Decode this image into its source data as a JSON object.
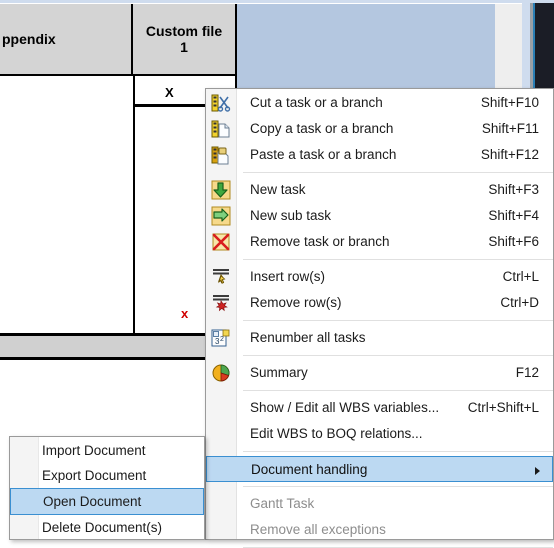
{
  "grid": {
    "columns": [
      {
        "name": "appendix-header",
        "label": "ppendix"
      },
      {
        "name": "custom-file-1-header",
        "label": "Custom file\n1"
      }
    ],
    "cells": [
      {
        "name": "custom-file-mark",
        "value": "X",
        "color": "#000000"
      },
      {
        "name": "appendix-mark",
        "value": "x",
        "color": "#d00000"
      }
    ]
  },
  "context_menu": {
    "name": "task-context-menu",
    "items": [
      {
        "id": "cut",
        "label": "Cut a task or a branch",
        "accel": "Shift+F10",
        "icon": "cut-icon",
        "state": "normal"
      },
      {
        "id": "copy",
        "label": "Copy a task or a branch",
        "accel": "Shift+F11",
        "icon": "copy-icon",
        "state": "normal"
      },
      {
        "id": "paste",
        "label": "Paste a task or a branch",
        "accel": "Shift+F12",
        "icon": "paste-icon",
        "state": "normal"
      },
      {
        "id": "sep1",
        "type": "separator"
      },
      {
        "id": "new-task",
        "label": "New task",
        "accel": "Shift+F3",
        "icon": "down-arrow-icon",
        "state": "normal"
      },
      {
        "id": "new-sub",
        "label": "New sub task",
        "accel": "Shift+F4",
        "icon": "right-arrow-icon",
        "state": "normal"
      },
      {
        "id": "remove-task",
        "label": "Remove task or branch",
        "accel": "Shift+F6",
        "icon": "red-x-icon",
        "state": "normal"
      },
      {
        "id": "sep2",
        "type": "separator"
      },
      {
        "id": "insert-rows",
        "label": "Insert row(s)",
        "accel": "Ctrl+L",
        "icon": "insert-row-icon",
        "state": "normal"
      },
      {
        "id": "remove-rows",
        "label": "Remove row(s)",
        "accel": "Ctrl+D",
        "icon": "remove-row-icon",
        "state": "normal"
      },
      {
        "id": "sep3",
        "type": "separator"
      },
      {
        "id": "renumber",
        "label": "Renumber all tasks",
        "accel": "",
        "icon": "renumber-icon",
        "state": "normal"
      },
      {
        "id": "sep4",
        "type": "separator"
      },
      {
        "id": "summary",
        "label": "Summary",
        "accel": "F12",
        "icon": "pie-chart-icon",
        "state": "normal"
      },
      {
        "id": "sep5",
        "type": "separator"
      },
      {
        "id": "wbs-vars",
        "label": "Show / Edit all WBS variables...",
        "accel": "Ctrl+Shift+L",
        "icon": "",
        "state": "normal"
      },
      {
        "id": "wbs-boq",
        "label": "Edit WBS to BOQ relations...",
        "accel": "",
        "icon": "",
        "state": "normal"
      },
      {
        "id": "sep6",
        "type": "separator"
      },
      {
        "id": "doc-handling",
        "label": "Document handling",
        "accel": "",
        "icon": "",
        "state": "highlighted",
        "submenu": true
      },
      {
        "id": "sep7",
        "type": "separator"
      },
      {
        "id": "gantt-task",
        "label": "Gantt Task",
        "accel": "",
        "icon": "",
        "state": "disabled"
      },
      {
        "id": "remove-exc",
        "label": "Remove all exceptions",
        "accel": "",
        "icon": "",
        "state": "disabled"
      },
      {
        "id": "sep8",
        "type": "separator"
      }
    ]
  },
  "submenu": {
    "name": "document-handling-submenu",
    "items": [
      {
        "id": "import-doc",
        "label": "Import Document",
        "state": "normal"
      },
      {
        "id": "export-doc",
        "label": "Export Document",
        "state": "normal"
      },
      {
        "id": "open-doc",
        "label": "Open Document",
        "state": "highlighted"
      },
      {
        "id": "delete-doc",
        "label": "Delete Document(s)",
        "state": "normal"
      }
    ]
  },
  "colors": {
    "selection_band": "#b4c7e0",
    "highlight": "#bcd9f2",
    "highlight_border": "#3a8fd1",
    "header_fill": "#d4d4d4",
    "disabled_text": "#8d8d8d",
    "red_mark": "#d00000"
  }
}
